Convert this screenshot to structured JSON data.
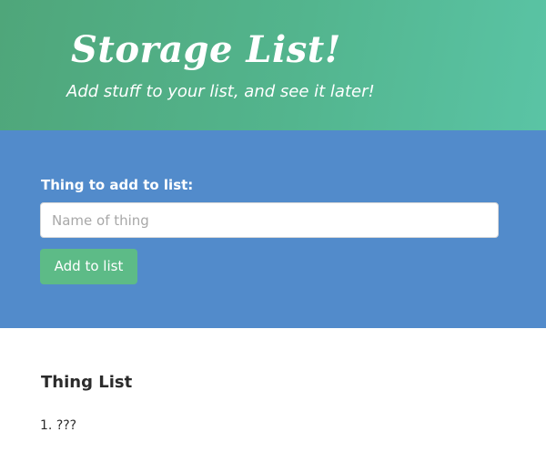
{
  "header": {
    "title": "Storage List!",
    "subtitle": "Add stuff to your list, and see it later!"
  },
  "form": {
    "label": "Thing to add to list:",
    "input_value": "",
    "input_placeholder": "Name of thing",
    "button_label": "Add to list"
  },
  "list": {
    "heading": "Thing List",
    "items": [
      {
        "number": "1.",
        "text": "???"
      }
    ]
  },
  "colors": {
    "header_gradient_start": "#4fa67a",
    "header_gradient_end": "#5ac4a5",
    "form_background": "#528bcb",
    "button_background": "#5dbb87"
  }
}
